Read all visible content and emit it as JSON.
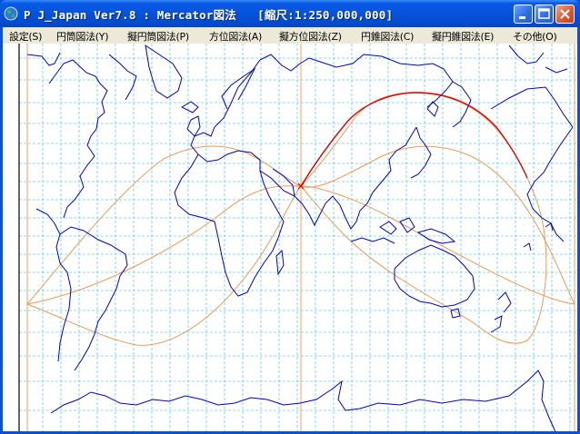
{
  "window": {
    "title": "P J_Japan Ver7.8 : Mercator図法   [縮尺:1:250,000,000]"
  },
  "menu": {
    "items": [
      {
        "label": "設定(S)"
      },
      {
        "label": "円筒図法(Y)"
      },
      {
        "label": "擬円筒図法(P)"
      },
      {
        "label": "方位図法(A)"
      },
      {
        "label": "擬方位図法(Z)"
      },
      {
        "label": "円錐図法(C)"
      },
      {
        "label": "擬円錐図法(E)"
      },
      {
        "label": "その他(O)"
      }
    ]
  },
  "map": {
    "projection": "Mercator",
    "colors": {
      "coastline": "#0000cc",
      "graticule": "#66ccff",
      "great_circle": "#ee9955",
      "route": "#dd0000",
      "meridian_line": "#f0a060",
      "edge_line": "#000000"
    }
  }
}
